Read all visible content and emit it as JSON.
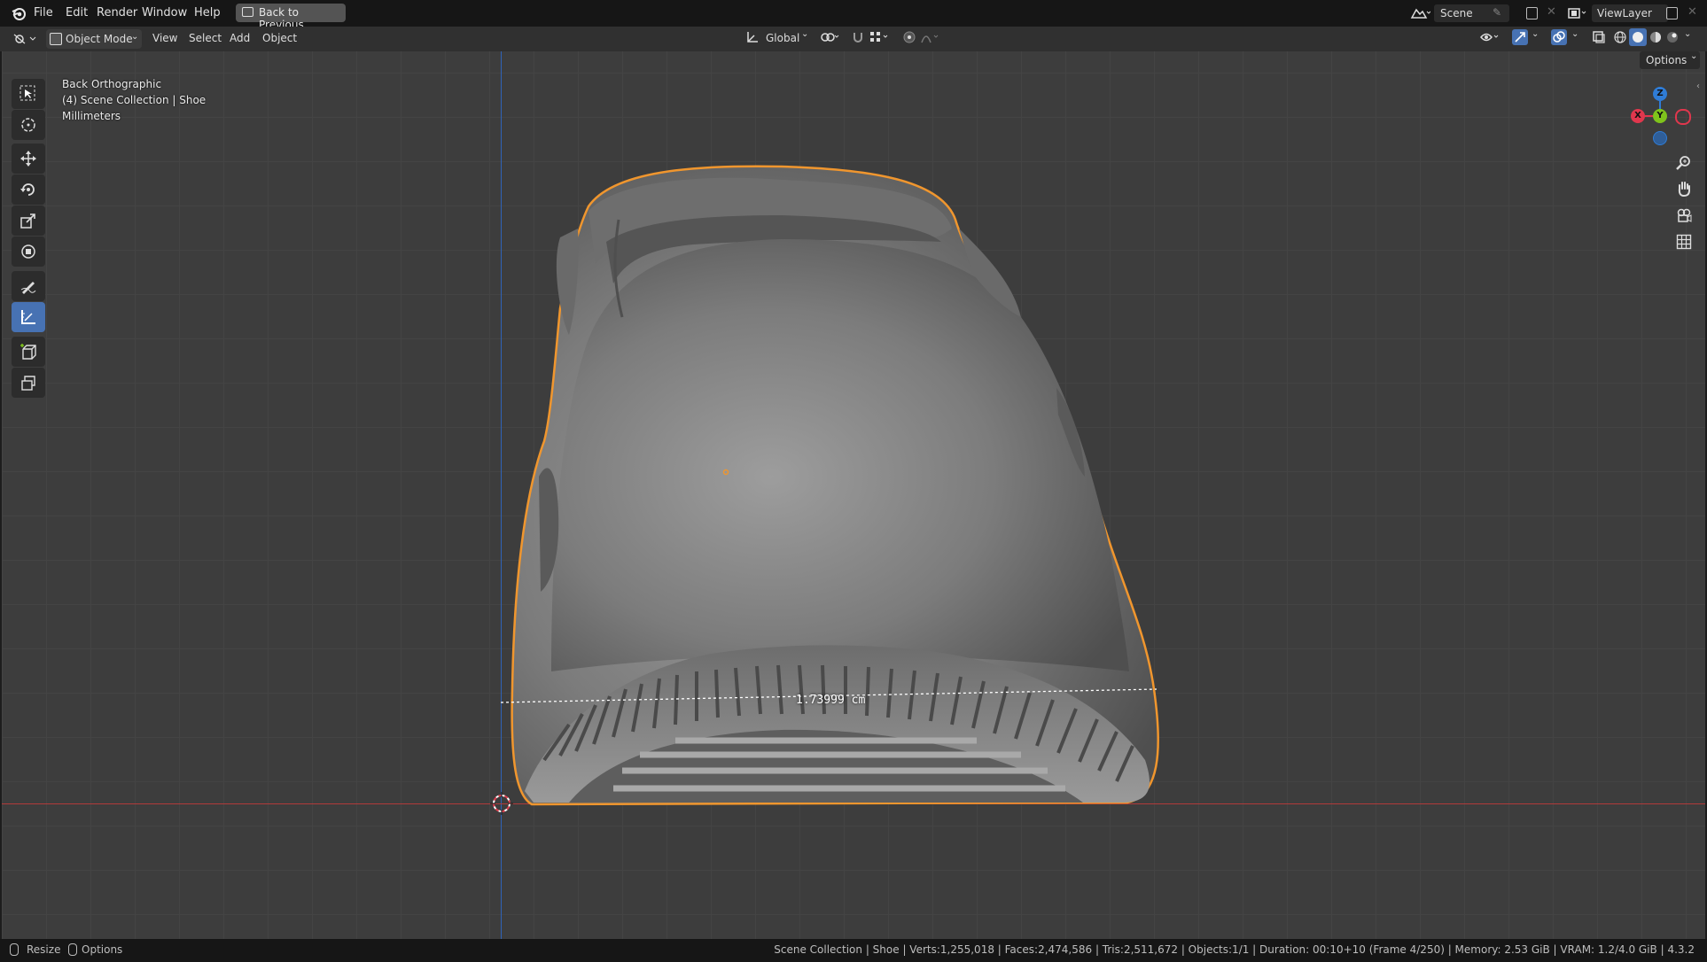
{
  "menu": {
    "items": [
      "File",
      "Edit",
      "Render",
      "Window",
      "Help"
    ],
    "back_to_previous": "Back to Previous",
    "scene_label": "Scene",
    "view_layer_label": "ViewLayer"
  },
  "header": {
    "mode": "Object Mode",
    "menus": [
      "View",
      "Select",
      "Add",
      "Object"
    ],
    "orientation": "Global",
    "options": "Options"
  },
  "viewport_info": {
    "view_name": "Back Orthographic",
    "collection": "(4) Scene Collection | Shoe",
    "units": "Millimeters"
  },
  "measurement": {
    "value": "1.73999 cm"
  },
  "gizmo": {
    "z": "Z",
    "y": "Y",
    "x": "X"
  },
  "status": {
    "left_items": [
      "Resize",
      "Options"
    ],
    "right_text": "Scene Collection | Shoe | Verts:1,255,018 | Faces:2,474,586 | Tris:2,511,672 | Objects:1/1 | Duration: 00:10+10 (Frame 4/250) | Memory: 2.53 GiB | VRAM: 1.2/4.0 GiB | 4.3.2"
  },
  "colors": {
    "accent": "#4772b3",
    "selection_outline": "#f0962e",
    "x_axis": "#e0374d",
    "y_axis": "#7fc31c",
    "z_axis": "#2f7cd6"
  },
  "icons": {
    "tools": [
      "select-box-icon",
      "cursor-icon",
      "move-icon",
      "rotate-icon",
      "scale-icon",
      "transform-icon",
      "annotate-icon",
      "measure-icon",
      "add-cube-icon",
      "extrude-icon"
    ],
    "nav": [
      "zoom-icon",
      "pan-hand-icon",
      "camera-icon",
      "grid-icon"
    ]
  }
}
